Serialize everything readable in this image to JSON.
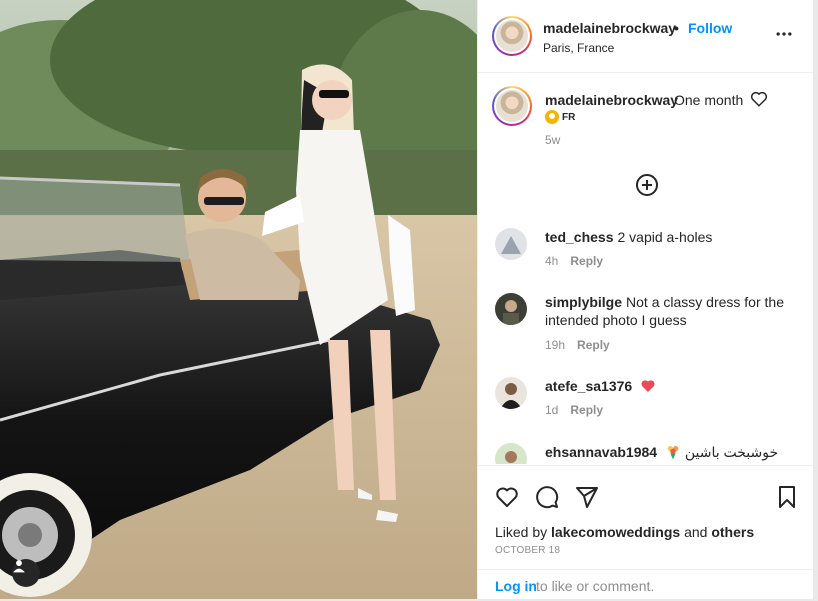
{
  "post": {
    "username": "madelainebrockway",
    "dot": "•",
    "follow_label": "Follow",
    "location": "Paris, France",
    "more_icon": "more-horizontal-icon"
  },
  "caption": {
    "username": "madelainebrockway",
    "text": "One month",
    "heart_icon": "heart-outline-icon",
    "flag_label": "FR",
    "time": "5w"
  },
  "load_more_icon": "plus-circle-icon",
  "comments": [
    {
      "username": "ted_chess",
      "text": "2 vapid a-holes",
      "time": "4h",
      "reply": "Reply"
    },
    {
      "username": "simplybilge",
      "text": "Not a classy dress for the intended photo I guess",
      "time": "19h",
      "reply": "Reply"
    },
    {
      "username": "atefe_sa1376",
      "text": "",
      "time": "1d",
      "reply": "Reply",
      "emoji": "red-heart"
    },
    {
      "username": "ehsannavab1984",
      "text": "خوشبخت باشین",
      "time": "",
      "reply": "",
      "emoji": "bouquet"
    }
  ],
  "actions": {
    "like_icon": "heart-icon",
    "comment_icon": "comment-icon",
    "share_icon": "send-icon",
    "save_icon": "bookmark-icon"
  },
  "likes": {
    "prefix": "Liked by",
    "user": "lakecomoweddings",
    "and": "and",
    "others": "others"
  },
  "date": "OCTOBER 18",
  "login": {
    "link": "Log in",
    "rest": "to like or comment."
  },
  "colors": {
    "accent": "#0095f6",
    "secondary_text": "#8e8e8e",
    "heart_red": "#ed4956"
  }
}
